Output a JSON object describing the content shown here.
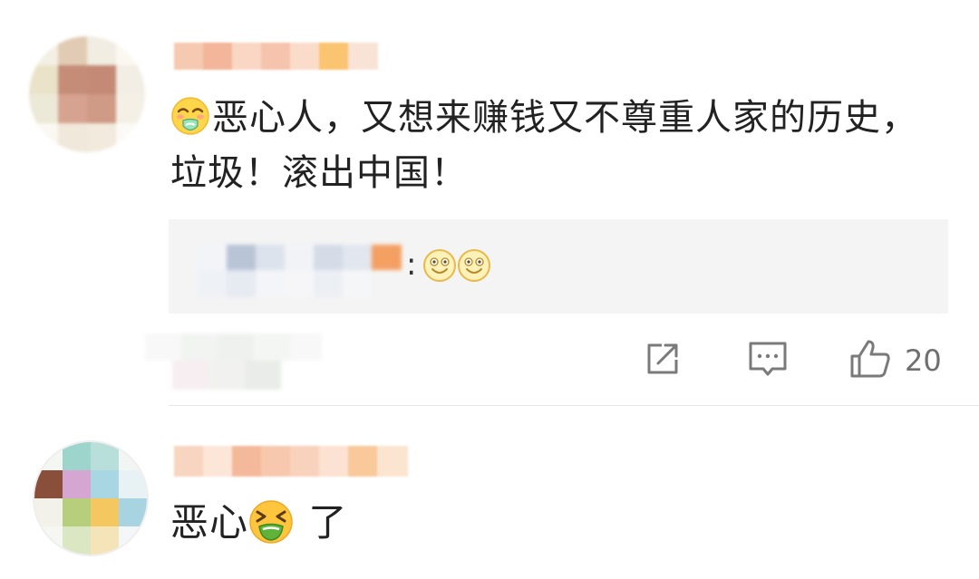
{
  "comments": [
    {
      "text_emoji": "vomiting-face",
      "text": "恶心人，又想来赚钱又不尊重人家的历史，垃圾！滚出中国！",
      "reply": {
        "colon": ":",
        "emojis": [
          "smile-coin-icon",
          "smile-coin-icon"
        ]
      },
      "actions": {
        "share_icon": "share-icon",
        "comment_icon": "comment-icon",
        "like_icon": "thumbs-up-icon",
        "like_count": "20"
      }
    },
    {
      "text_before": "恶心",
      "text_emoji": "nauseated-face",
      "text_after": " 了"
    }
  ],
  "colors": {
    "text": "#222222",
    "meta": "#6f6f6f",
    "reply_bg": "#f4f4f4",
    "divider": "#e6e6e6"
  }
}
